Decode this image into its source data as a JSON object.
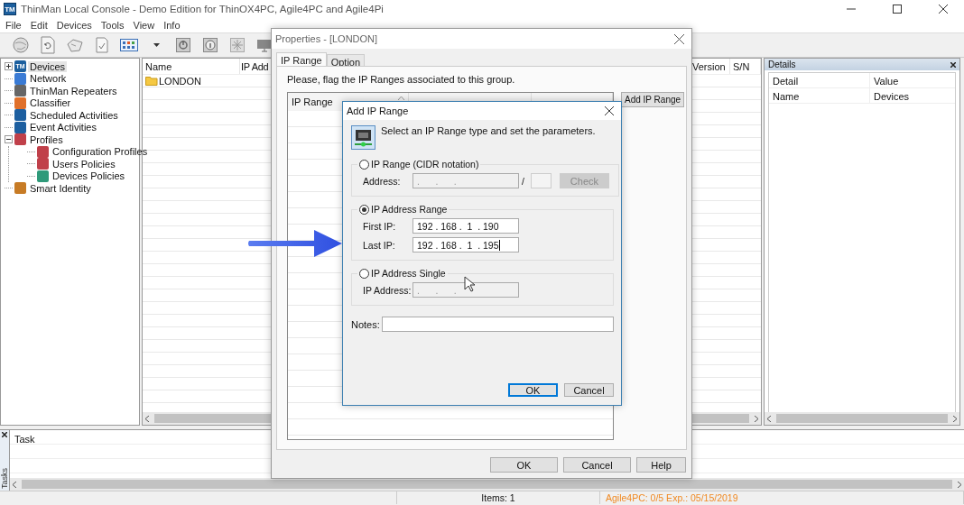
{
  "window": {
    "logo": "TM",
    "title": "ThinMan Local Console - Demo Edition for ThinOX4PC, Agile4PC and Agile4Pi"
  },
  "menu": [
    "File",
    "Edit",
    "Devices",
    "Tools",
    "View",
    "Info"
  ],
  "tree": [
    {
      "label": "Devices",
      "icon_text": "TM",
      "kind": "folder",
      "expanded": false,
      "selected": true
    },
    {
      "label": "Network",
      "kind": "leaf",
      "selected": false
    },
    {
      "label": "ThinMan Repeaters",
      "kind": "leaf",
      "selected": false
    },
    {
      "label": "Classifier",
      "kind": "leaf",
      "selected": false
    },
    {
      "label": "Scheduled Activities",
      "kind": "leaf",
      "selected": false
    },
    {
      "label": "Event Activities",
      "kind": "leaf",
      "selected": false
    },
    {
      "label": "Profiles",
      "kind": "folder",
      "expanded": true,
      "selected": false,
      "children": [
        {
          "label": "Configuration Profiles",
          "kind": "leaf",
          "selected": false
        },
        {
          "label": "Users Policies",
          "kind": "leaf",
          "selected": false
        },
        {
          "label": "Devices Policies",
          "kind": "leaf",
          "selected": false
        }
      ]
    },
    {
      "label": "Smart Identity",
      "kind": "leaf",
      "selected": false
    }
  ],
  "list": {
    "columns": [
      "Name",
      "IP Add",
      "Version",
      "S/N"
    ],
    "rows": [
      {
        "name": "LONDON"
      }
    ]
  },
  "details": {
    "title": "Details",
    "columns": [
      "Detail",
      "Value"
    ],
    "rows": [
      [
        "Name",
        "Devices"
      ]
    ]
  },
  "tasks": {
    "side_label": "Tasks",
    "columns": [
      "Task"
    ]
  },
  "status_bar": {
    "items": "Items: 1",
    "license": "Agile4PC: 0/5 Exp.: 05/15/2019"
  },
  "properties": {
    "title": "Properties - [LONDON]",
    "tabs": [
      {
        "label": "IP Range",
        "selected": true
      },
      {
        "label": "Option",
        "selected": false
      }
    ],
    "instruction": "Please, flag the IP Ranges associated to this group.",
    "columns": [
      "IP Range"
    ],
    "add_button": "Add IP Range",
    "buttons": [
      "OK",
      "Cancel",
      "Help"
    ]
  },
  "add_dialog": {
    "title": "Add IP Range",
    "instruction": "Select an IP Range type and set the parameters.",
    "groups": [
      {
        "kind": "cidr",
        "label": "IP Range (CIDR notation)",
        "selected": false,
        "field_label": "Address:",
        "value": ".      .      .",
        "separator": "/",
        "check_button": "Check"
      },
      {
        "kind": "range",
        "label": "IP Address Range",
        "selected": true,
        "first_label": "First IP:",
        "first_value": "192 . 168 .  1  . 190",
        "last_label": "Last IP:",
        "last_value": "192 . 168 .  1  . 195"
      },
      {
        "kind": "single",
        "label": "IP Address Single",
        "selected": false,
        "field_label": "IP Address:",
        "value": ".      .      ."
      }
    ],
    "notes_label": "Notes:",
    "buttons": [
      {
        "label": "OK",
        "default": true
      },
      {
        "label": "Cancel",
        "default": false
      }
    ]
  }
}
